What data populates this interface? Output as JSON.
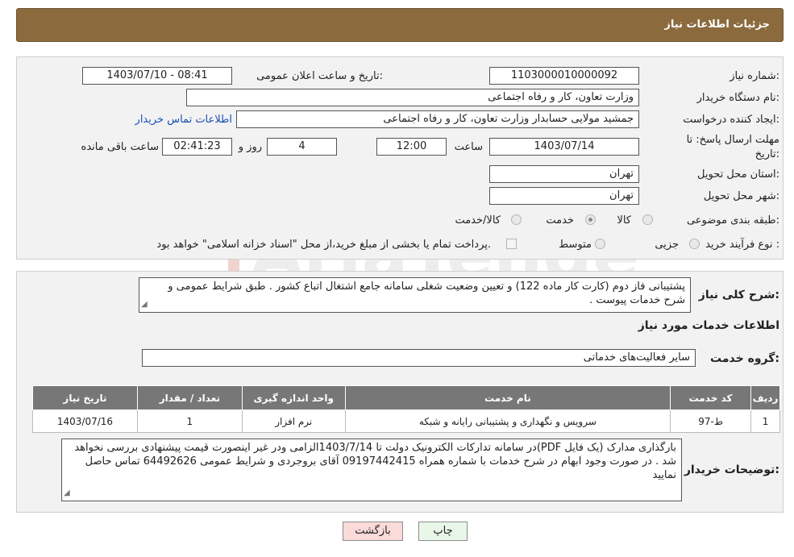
{
  "header": {
    "title": "جزئیات اطلاعات نیاز"
  },
  "form": {
    "need_number_label": "شماره نیاز:",
    "need_number": "1103000010000092",
    "announce_label": "تاریخ و ساعت اعلان عمومی:",
    "announce_value": "1403/07/10 - 08:41",
    "buyer_org_label": "نام دستگاه خریدار:",
    "buyer_org": "وزارت تعاون، کار و رفاه اجتماعی",
    "creator_label": "ایجاد کننده درخواست:",
    "creator": "جمشید مولایی حسابدار وزارت تعاون، کار و رفاه اجتماعی",
    "contact_link": "اطلاعات تماس خریدار",
    "deadline_label_1": "مهلت ارسال پاسخ: تا",
    "deadline_label_2": "تاریخ:",
    "deadline_date": "1403/07/14",
    "time_label": "ساعت",
    "deadline_time": "12:00",
    "days_value": "4",
    "days_label": "روز و",
    "remaining_time": "02:41:23",
    "remaining_label": "ساعت باقی مانده",
    "province_label": "استان محل تحویل:",
    "province": "تهران",
    "city_label": "شهر محل تحویل:",
    "city": "تهران",
    "category_label": "طبقه بندی موضوعی:",
    "category_options": [
      "کالا",
      "خدمت",
      "کالا/خدمت"
    ],
    "category_selected": "خدمت",
    "purchase_type_label": "نوع فرآیند خرید :",
    "purchase_options": [
      "جزیی",
      "متوسط"
    ],
    "purchase_note": "پرداخت تمام یا بخشی از مبلغ خرید،از محل \"اسناد خزانه اسلامی\" خواهد بود."
  },
  "details": {
    "summary_label": "شرح کلی نیاز:",
    "summary": "پشتیبانی فاز دوم (کارت کار ماده 122) و تعیین وضعیت شغلی سامانه جامع اشتغال اتباع کشور . طبق شرایط عمومی و شرح خدمات پیوست .",
    "services_heading": "اطلاعات خدمات مورد نیاز",
    "service_group_label": "گروه خدمت:",
    "service_group": "سایر فعالیت‌های خدماتی",
    "table": {
      "headers": [
        "ردیف",
        "کد خدمت",
        "نام خدمت",
        "واحد اندازه گیری",
        "تعداد / مقدار",
        "تاریخ نیاز"
      ],
      "rows": [
        [
          "1",
          "ط-97",
          "سرویس و نگهداری و پشتیبانی رایانه و شبکه",
          "نرم افزار",
          "1",
          "1403/07/16"
        ]
      ]
    },
    "buyer_notes_label": "توضیحات خریدار:",
    "buyer_notes": "بارگذاری مدارک (یک فایل PDF)در سامانه تدارکات الکترونیک دولت تا 1403/7/14الزامی ودر غیر اینصورت قیمت پیشنهادی بررسی نخواهد شد . در صورت وجود ابهام در شرح خدمات با شماره همراه 09197442415 آقای بروجردی و شرایط عمومی 64492626 تماس حاصل نمایید"
  },
  "buttons": {
    "print": "چاپ",
    "back": "بازگشت"
  },
  "watermark": {
    "text": "AriaTender.neT"
  }
}
